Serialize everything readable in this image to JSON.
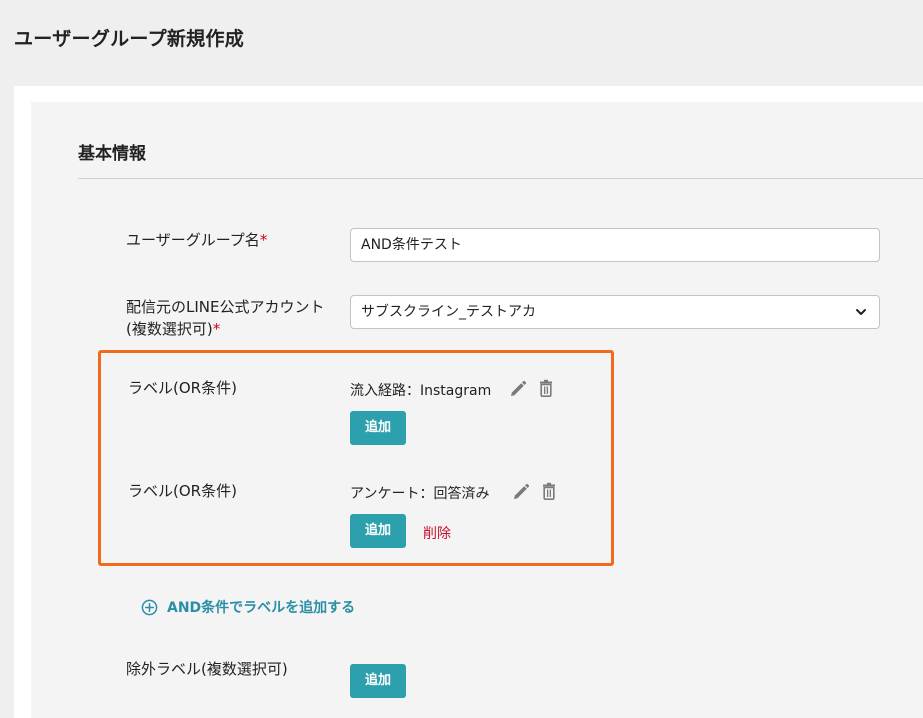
{
  "page": {
    "title": "ユーザーグループ新規作成"
  },
  "basic_info": {
    "section_title": "基本情報",
    "group_name": {
      "label": "ユーザーグループ名",
      "required_mark": "*",
      "value": "AND条件テスト"
    },
    "line_account": {
      "label_line1": "配信元のLINE公式アカウント",
      "label_line2": "(複数選択可)",
      "required_mark": "*",
      "selected": "サブスクライン_テストアカ"
    }
  },
  "label_conditions": [
    {
      "label": "ラベル(OR条件)",
      "tag": "流入経路：Instagram",
      "add_label": "追加"
    },
    {
      "label": "ラベル(OR条件)",
      "tag": "アンケート：回答済み",
      "add_label": "追加",
      "delete_label": "削除"
    }
  ],
  "and_condition": {
    "link_label": "AND条件でラベルを追加する"
  },
  "exclude_labels": {
    "label": "除外ラベル(複数選択可)",
    "add_label": "追加"
  },
  "colors": {
    "accent": "#2da0ae",
    "highlight": "#f26b1d",
    "danger": "#c8102e",
    "link": "#2a8fa6"
  }
}
